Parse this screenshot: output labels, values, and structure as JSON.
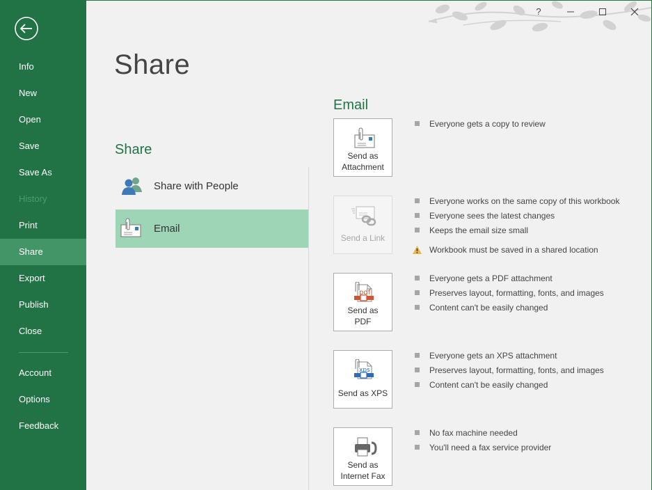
{
  "sidebar": {
    "back_label": "Back",
    "items": [
      {
        "label": "Info",
        "state": "normal"
      },
      {
        "label": "New",
        "state": "normal"
      },
      {
        "label": "Open",
        "state": "normal"
      },
      {
        "label": "Save",
        "state": "normal"
      },
      {
        "label": "Save As",
        "state": "normal"
      },
      {
        "label": "History",
        "state": "disabled"
      },
      {
        "label": "Print",
        "state": "normal"
      },
      {
        "label": "Share",
        "state": "active"
      },
      {
        "label": "Export",
        "state": "normal"
      },
      {
        "label": "Publish",
        "state": "normal"
      },
      {
        "label": "Close",
        "state": "normal"
      }
    ],
    "bottom_items": [
      {
        "label": "Account"
      },
      {
        "label": "Options"
      },
      {
        "label": "Feedback"
      }
    ]
  },
  "window_controls": {
    "help": "?",
    "minimize": "minimize",
    "maximize": "maximize",
    "close": "close"
  },
  "page": {
    "title": "Share",
    "section_title": "Share",
    "share_options": [
      {
        "label": "Share with People",
        "icon": "people-icon",
        "selected": false
      },
      {
        "label": "Email",
        "icon": "email-attachment-icon",
        "selected": true
      }
    ]
  },
  "email": {
    "title": "Email",
    "options": [
      {
        "label_line1": "Send as",
        "label_line2": "Attachment",
        "icon": "email-attachment-icon",
        "enabled": true,
        "bullets": [
          "Everyone gets a copy to review"
        ],
        "warning": null
      },
      {
        "label_line1": "Send a Link",
        "label_line2": "",
        "icon": "email-link-icon",
        "enabled": false,
        "bullets": [
          "Everyone works on the same copy of this workbook",
          "Everyone sees the latest changes",
          "Keeps the email size small"
        ],
        "warning": "Workbook must be saved in a shared location"
      },
      {
        "label_line1": "Send as",
        "label_line2": "PDF",
        "icon": "pdf-icon",
        "enabled": true,
        "bullets": [
          "Everyone gets a PDF attachment",
          "Preserves layout, formatting, fonts, and images",
          "Content can't be easily changed"
        ],
        "warning": null
      },
      {
        "label_line1": "Send as XPS",
        "label_line2": "",
        "icon": "xps-icon",
        "enabled": true,
        "bullets": [
          "Everyone gets an XPS attachment",
          "Preserves layout, formatting, fonts, and images",
          "Content can't be easily changed"
        ],
        "warning": null
      },
      {
        "label_line1": "Send as",
        "label_line2": "Internet Fax",
        "icon": "fax-icon",
        "enabled": true,
        "bullets": [
          "No fax machine needed",
          "You'll need a fax service provider"
        ],
        "warning": null
      }
    ]
  },
  "colors": {
    "brand_green": "#217346",
    "active_nav": "#439467",
    "selected_option": "#9fd5b7",
    "pdf_red": "#d35230",
    "xps_blue": "#2e6db4",
    "warning_yellow": "#e8b64c"
  }
}
